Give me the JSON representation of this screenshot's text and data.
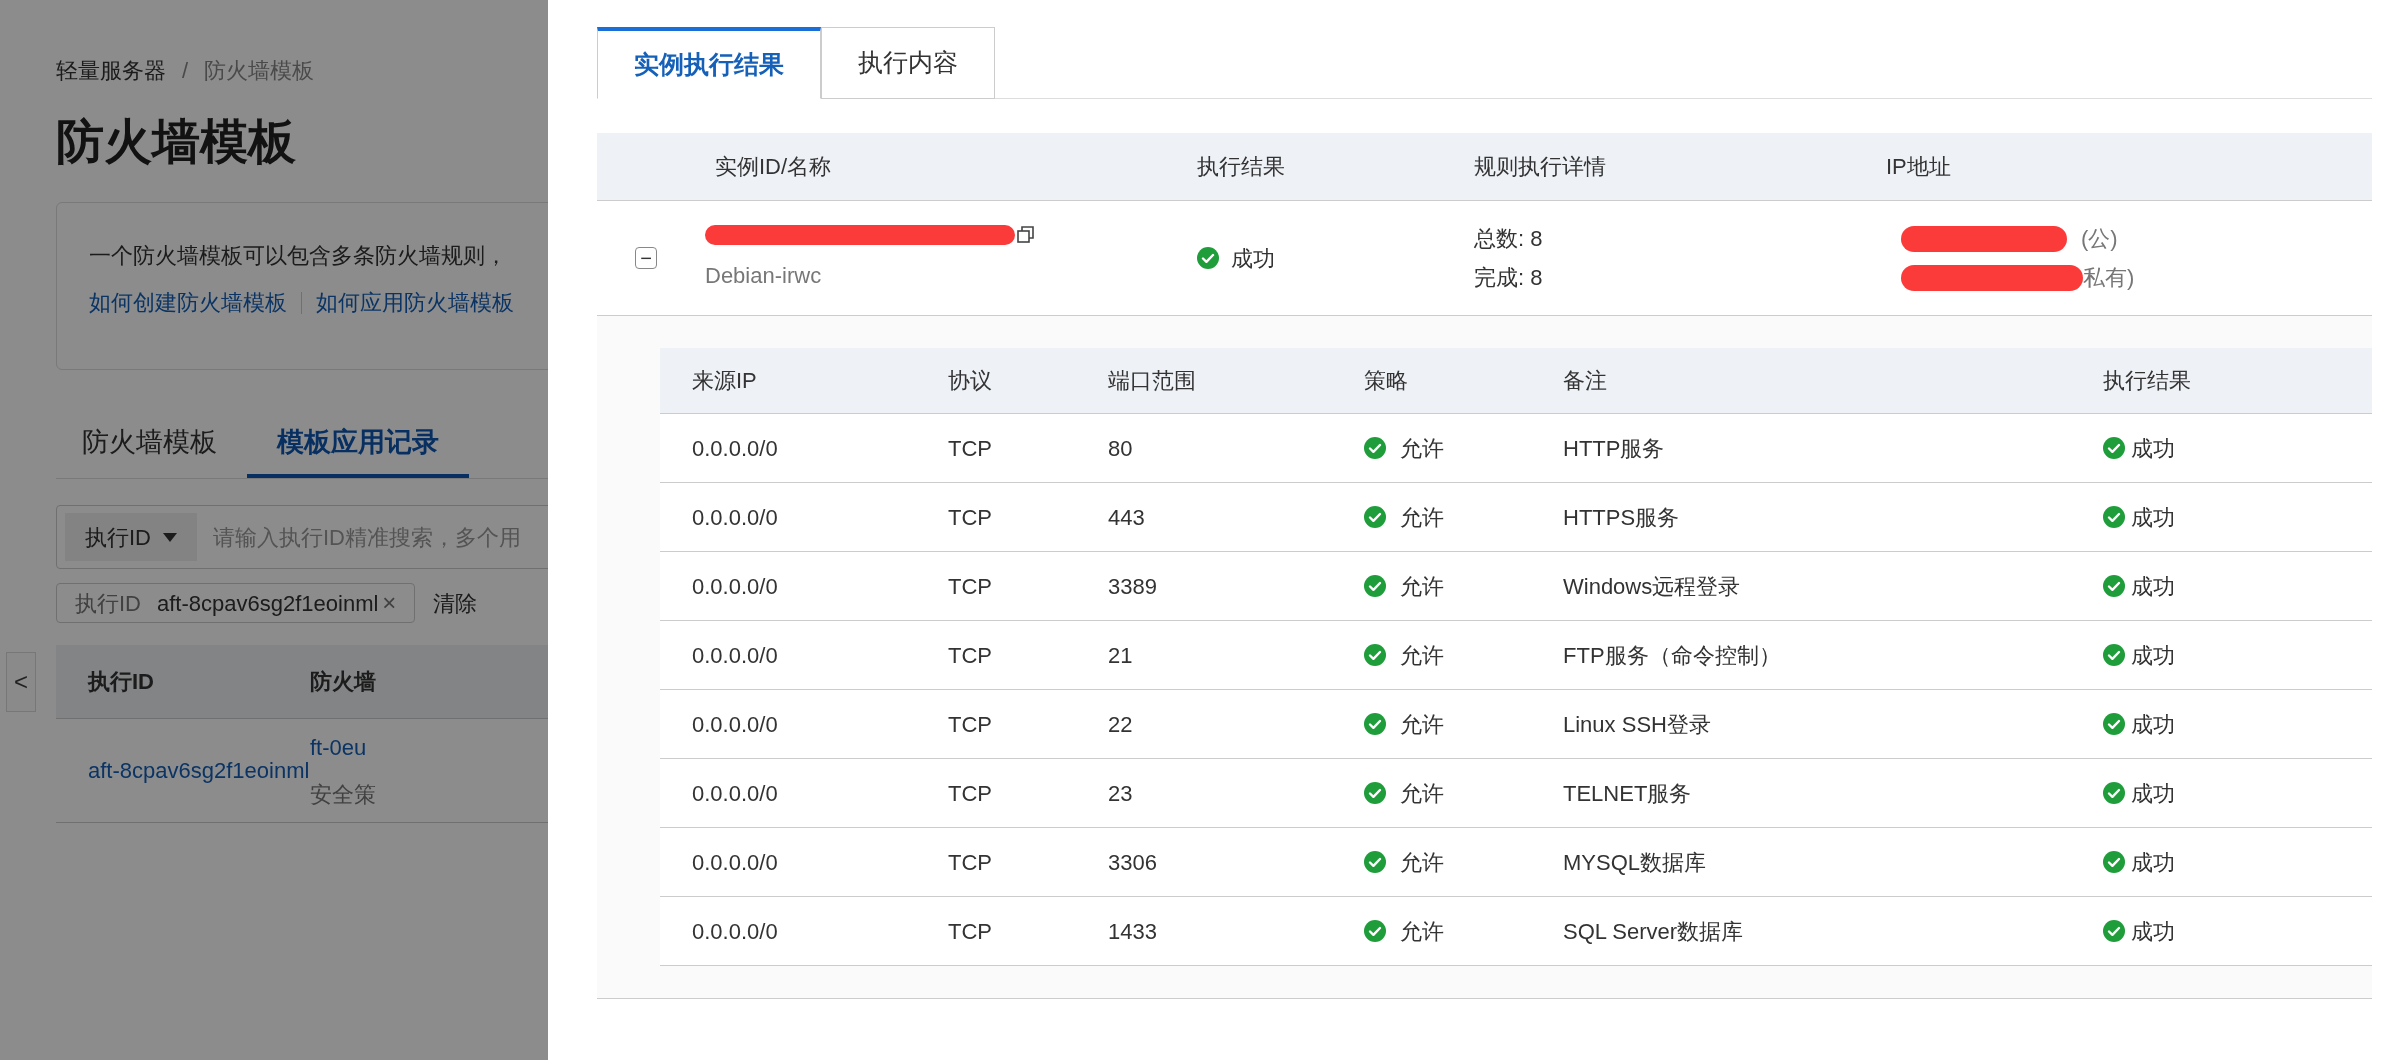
{
  "page": {
    "breadcrumb": [
      "轻量服务器",
      "防火墙模板"
    ],
    "breadcrumb_separator": "/",
    "title": "防火墙模板",
    "info": {
      "text": "一个防火墙模板可以包含多条防火墙规则，",
      "links": [
        "如何创建防火墙模板",
        "如何应用防火墙模板"
      ]
    },
    "tabs": [
      {
        "label": "防火墙模板",
        "selected": false
      },
      {
        "label": "模板应用记录",
        "selected": true
      }
    ],
    "search": {
      "field_selector": "执行ID",
      "placeholder": "请输入执行ID精准搜索，多个用"
    },
    "filter_tag": {
      "key": "执行ID",
      "value": "aft-8cpav6sg2f1eoinml",
      "close": "×"
    },
    "clear_filter": "清除",
    "table": {
      "columns": [
        "执行ID",
        "防火墙"
      ],
      "rows": [
        {
          "id": "aft-8cpav6sg2f1eoinml",
          "template": "ft-0eu",
          "note": "安全策"
        }
      ]
    },
    "collapse_arrow": "<"
  },
  "drawer": {
    "tabs": [
      {
        "label": "实例执行结果",
        "selected": true
      },
      {
        "label": "执行内容",
        "selected": false
      }
    ],
    "instances": {
      "columns": [
        "实例ID/名称",
        "执行结果",
        "规则执行详情",
        "IP地址"
      ],
      "rows": [
        {
          "expanded": true,
          "toggle": "−",
          "name": "Debian-irwc",
          "result": "成功",
          "details": [
            "总数: 8",
            "完成: 8"
          ],
          "ip": [
            "(公)",
            "私有)"
          ]
        }
      ]
    },
    "rules": {
      "columns": [
        "来源IP",
        "协议",
        "端口范围",
        "策略",
        "备注",
        "执行结果"
      ],
      "rows": [
        {
          "source": "0.0.0.0/0",
          "protocol": "TCP",
          "ports": "80",
          "policy": "允许",
          "note": "HTTP服务",
          "result": "成功"
        },
        {
          "source": "0.0.0.0/0",
          "protocol": "TCP",
          "ports": "443",
          "policy": "允许",
          "note": "HTTPS服务",
          "result": "成功"
        },
        {
          "source": "0.0.0.0/0",
          "protocol": "TCP",
          "ports": "3389",
          "policy": "允许",
          "note": "Windows远程登录",
          "result": "成功"
        },
        {
          "source": "0.0.0.0/0",
          "protocol": "TCP",
          "ports": "21",
          "policy": "允许",
          "note": "FTP服务（命令控制）",
          "result": "成功"
        },
        {
          "source": "0.0.0.0/0",
          "protocol": "TCP",
          "ports": "22",
          "policy": "允许",
          "note": "Linux SSH登录",
          "result": "成功"
        },
        {
          "source": "0.0.0.0/0",
          "protocol": "TCP",
          "ports": "23",
          "policy": "允许",
          "note": "TELNET服务",
          "result": "成功"
        },
        {
          "source": "0.0.0.0/0",
          "protocol": "TCP",
          "ports": "3306",
          "policy": "允许",
          "note": "MYSQL数据库",
          "result": "成功"
        },
        {
          "source": "0.0.0.0/0",
          "protocol": "TCP",
          "ports": "1433",
          "policy": "允许",
          "note": "SQL Server数据库",
          "result": "成功"
        }
      ]
    }
  }
}
